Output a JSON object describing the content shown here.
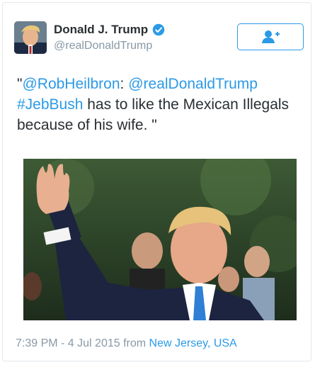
{
  "user": {
    "display_name": "Donald J. Trump",
    "handle": "@realDonaldTrump",
    "verified": true,
    "avatar_icon": "profile-photo"
  },
  "follow_button": {
    "icon": "add-user-icon"
  },
  "tweet": {
    "quote_open": "\"",
    "mention1": "@RobHeilbron",
    "colon": ": ",
    "mention2": "@realDonaldTrump",
    "hashtag": "#JebBush",
    "body": " has to like the Mexican Illegals because of his wife. \""
  },
  "photo": {
    "description_icon": "photo"
  },
  "meta": {
    "timestamp": "7:39 PM - 4 Jul 2015",
    "from": " from ",
    "place": "New Jersey, USA"
  },
  "colors": {
    "link": "#2b9ae7",
    "text": "#292f33",
    "muted": "#8899a6",
    "border": "#e1e8ed"
  }
}
